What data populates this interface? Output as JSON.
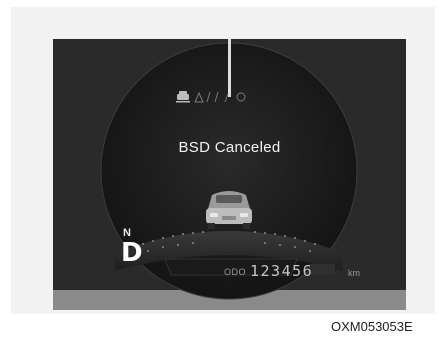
{
  "cluster": {
    "message": "BSD Canceled",
    "gear_indicator_small": "N",
    "gear": "D",
    "odometer_label": "ODO",
    "odometer_value": "123456",
    "odometer_unit": "km",
    "indicator_icons": [
      "lane-car-icon",
      "warning-lights-icon"
    ]
  },
  "figure_code": "OXM053053E",
  "colors": {
    "screen_bg": "#2a2a2a",
    "dial_bg": "#1a1a1a",
    "text": "#f2f2f2"
  }
}
